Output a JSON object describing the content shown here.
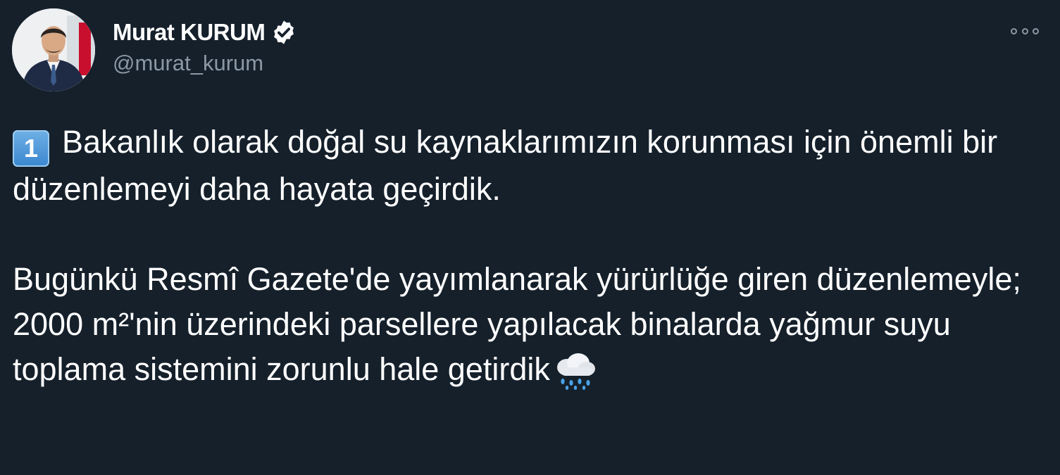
{
  "user": {
    "display_name": "Murat KURUM",
    "handle": "@murat_kurum",
    "verified_icon": "verified-badge-icon",
    "more_icon": "more-options-icon"
  },
  "tweet": {
    "keycap": "1",
    "paragraph1": "Bakanlık olarak doğal su kaynaklarımızın korunması için önemli bir düzenlemeyi daha hayata geçirdik.",
    "paragraph2": "Bugünkü  Resmî Gazete'de yayımlanarak yürürlüğe giren düzenlemeyle; 2000 m²'nin üzerindeki parsellere yapılacak binalarda yağmur suyu toplama sistemini zorunlu hale getirdik",
    "trailing_emoji": "cloud-with-rain-icon"
  },
  "colors": {
    "background": "#15202b",
    "secondary_text": "#8b98a5",
    "text": "#ffffff"
  }
}
